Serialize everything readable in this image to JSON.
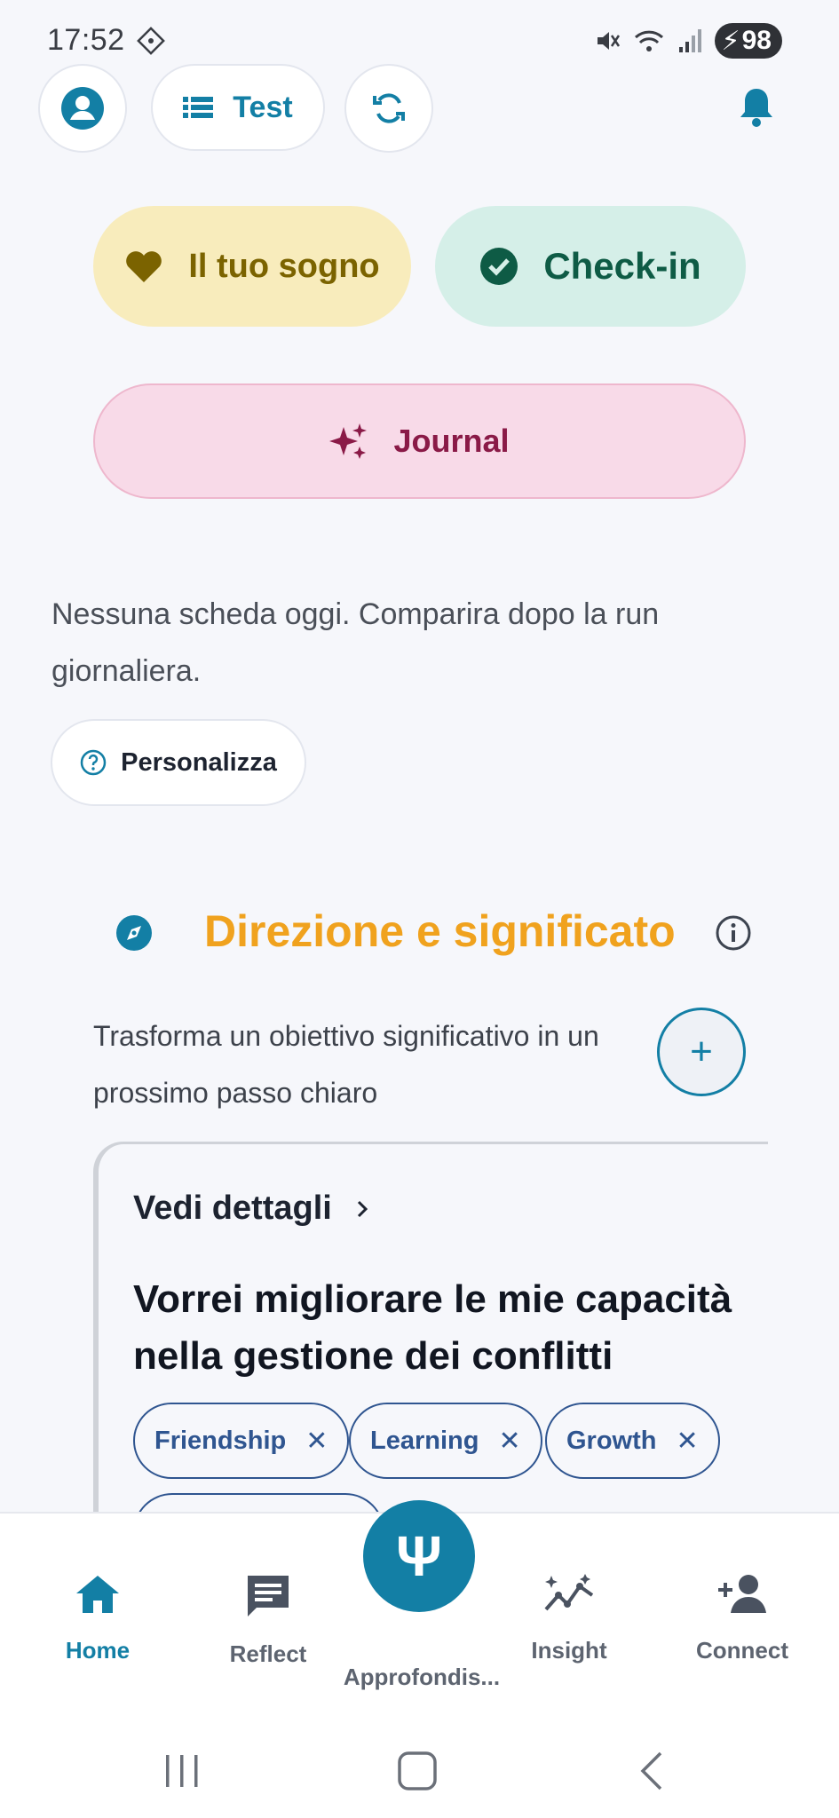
{
  "status_bar": {
    "time": "17:52",
    "battery": "98"
  },
  "top_bar": {
    "profile_icon": "account-circle-icon",
    "test_label": "Test",
    "sync_icon": "sync-icon",
    "bell_icon": "bell-icon"
  },
  "actions": {
    "dream_label": "Il tuo sogno",
    "checkin_label": "Check-in",
    "journal_label": "Journal"
  },
  "empty_state": {
    "message": "Nessuna scheda oggi. Comparira dopo la run giornaliera.",
    "personalize_label": "Personalizza"
  },
  "section": {
    "title": "Direzione e significato",
    "description": "Trasforma un obiettivo significativo in un prossimo passo chiaro"
  },
  "goal_card": {
    "details_label": "Vedi dettagli",
    "goal_text": "Vorrei migliorare le mie capacità nella  gestione dei conflitti",
    "tags": [
      "Friendship",
      "Learning",
      "Growth"
    ],
    "tag_remove_symbol": "✕"
  },
  "bottom_nav": {
    "items": [
      {
        "label": "Home",
        "icon": "home-icon"
      },
      {
        "label": "Reflect",
        "icon": "comment-icon"
      },
      {
        "label": "Approfondis...",
        "icon": "psi-icon"
      },
      {
        "label": "Insight",
        "icon": "insight-chart-icon"
      },
      {
        "label": "Connect",
        "icon": "add-person-icon"
      }
    ],
    "center_symbol": "Ψ"
  },
  "colors": {
    "accent": "#137fa5",
    "section_title": "#f0a21e",
    "dream_bg": "#f8ecbc",
    "checkin_bg": "#d5efe8",
    "journal_bg": "#f8dae8"
  }
}
